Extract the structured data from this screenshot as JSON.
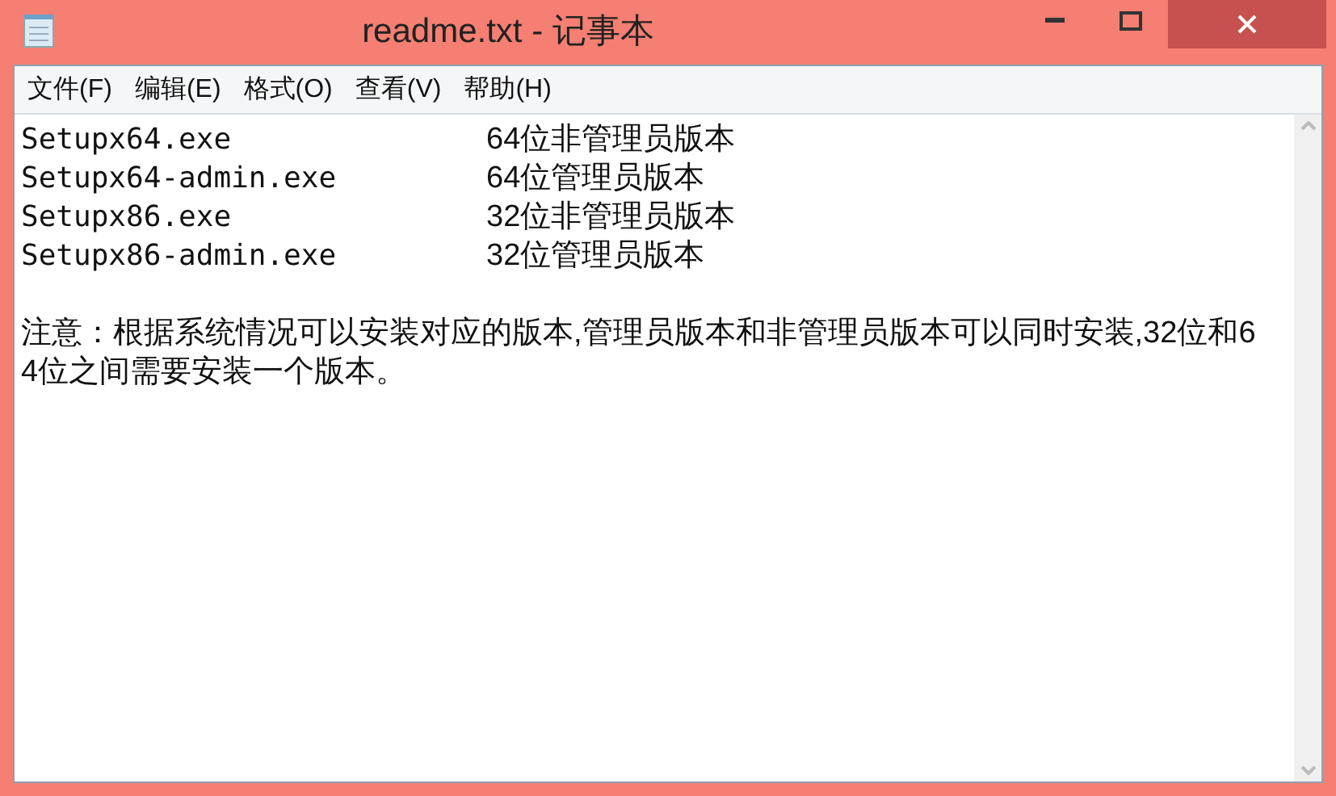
{
  "window": {
    "title": "readme.txt - 记事本"
  },
  "menu": [
    {
      "label": "文件(F)"
    },
    {
      "label": "编辑(E)"
    },
    {
      "label": "格式(O)"
    },
    {
      "label": "查看(V)"
    },
    {
      "label": "帮助(H)"
    }
  ],
  "editor": {
    "rows": [
      {
        "file": "Setupx64.exe",
        "description": "64位非管理员版本"
      },
      {
        "file": "Setupx64-admin.exe",
        "description": "64位管理员版本"
      },
      {
        "file": "Setupx86.exe",
        "description": "32位非管理员版本"
      },
      {
        "file": "Setupx86-admin.exe",
        "description": "32位管理员版本"
      }
    ],
    "note": "注意：根据系统情况可以安装对应的版本,管理员版本和非管理员版本可以同时安装,32位和64位之间需要安装一个版本。"
  }
}
